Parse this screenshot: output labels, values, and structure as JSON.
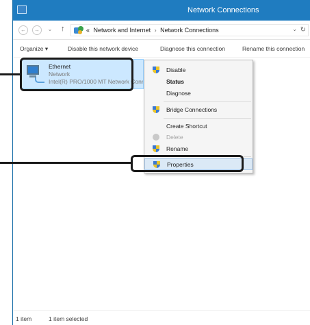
{
  "window": {
    "title": "Network Connections"
  },
  "address_bar": {
    "back_icon": "back-arrow-icon",
    "forward_icon": "forward-arrow-icon",
    "up_icon": "up-arrow-icon",
    "crumb_prefix": "«",
    "crumbs": [
      "Network and Internet",
      "Network Connections"
    ],
    "separator": "›"
  },
  "toolbar": {
    "organize": "Organize ▾",
    "disable": "Disable this network device",
    "diagnose": "Diagnose this connection",
    "rename": "Rename this connection"
  },
  "connection": {
    "name": "Ethernet",
    "type": "Network",
    "adapter": "Intel(R) PRO/1000 MT Network Connection"
  },
  "context_menu": {
    "items": [
      {
        "label": "Disable",
        "icon": "uac-shield-icon"
      },
      {
        "label": "Status",
        "icon": "",
        "bold": true
      },
      {
        "label": "Diagnose",
        "icon": ""
      },
      {
        "label": "Bridge Connections",
        "icon": "uac-shield-icon"
      },
      {
        "label": "Create Shortcut",
        "icon": ""
      },
      {
        "label": "Delete",
        "icon": "disabled-icon",
        "disabled": true
      },
      {
        "label": "Rename",
        "icon": "uac-shield-icon"
      },
      {
        "label": "Properties",
        "icon": "uac-shield-icon",
        "highlighted": true
      }
    ]
  },
  "status_bar": {
    "count": "1 item",
    "selected": "1 item selected"
  },
  "colors": {
    "titlebar": "#1f7cc0",
    "selection": "#cce8ff",
    "menu_highlight": "#dbe9f6",
    "callout": "#1a1a1a"
  }
}
